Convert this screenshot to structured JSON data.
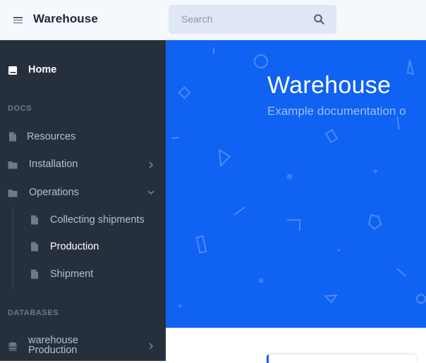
{
  "header": {
    "brand": "Warehouse",
    "search_placeholder": "Search"
  },
  "sidebar": {
    "home_label": "Home",
    "docs_title": "DOCS",
    "items": [
      {
        "label": "Resources",
        "icon": "file-icon"
      },
      {
        "label": "Installation",
        "icon": "folder-icon"
      },
      {
        "label": "Operations",
        "icon": "folder-icon"
      }
    ],
    "sub_items": [
      {
        "label": "Collecting shipments"
      },
      {
        "label": "Production"
      },
      {
        "label": "Shipment"
      }
    ],
    "databases_title": "DATABASES",
    "database_item": {
      "line1": "warehouse",
      "line2": "Production"
    }
  },
  "hero": {
    "title": "Warehouse",
    "subtitle": "Example documentation o"
  },
  "colors": {
    "accent": "#0f62f2",
    "sidebar_bg": "#26303d",
    "topbar_bg": "#f5f8fd"
  }
}
